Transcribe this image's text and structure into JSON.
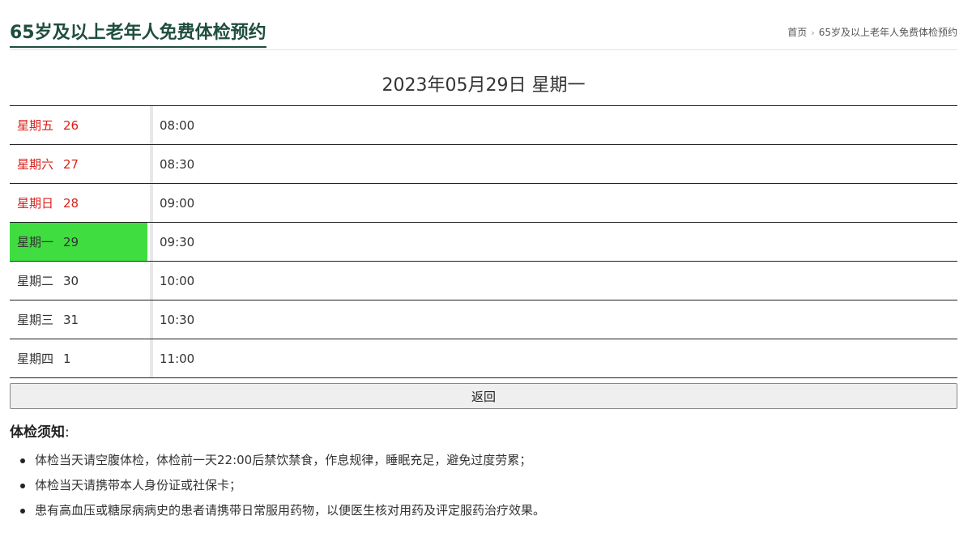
{
  "header": {
    "title": "65岁及以上老年人免费体检预约",
    "breadcrumb": {
      "home": "首页",
      "current": "65岁及以上老年人免费体检预约"
    }
  },
  "date_heading": "2023年05月29日 星期一",
  "schedule": [
    {
      "weekday": "星期五",
      "day": "26",
      "time": "08:00",
      "state": "weekend"
    },
    {
      "weekday": "星期六",
      "day": "27",
      "time": "08:30",
      "state": "weekend"
    },
    {
      "weekday": "星期日",
      "day": "28",
      "time": "09:00",
      "state": "weekend"
    },
    {
      "weekday": "星期一",
      "day": "29",
      "time": "09:30",
      "state": "selected"
    },
    {
      "weekday": "星期二",
      "day": "30",
      "time": "10:00",
      "state": "normal"
    },
    {
      "weekday": "星期三",
      "day": "31",
      "time": "10:30",
      "state": "normal"
    },
    {
      "weekday": "星期四",
      "day": "1",
      "time": "11:00",
      "state": "normal"
    }
  ],
  "colors": {
    "title": "#1f4e3d",
    "weekend_text": "#d9211b",
    "selected_bg": "#3fdd3f"
  },
  "back_button": "返回",
  "notice": {
    "title": "体检须知",
    "colon": ":",
    "items": [
      "体检当天请空腹体检，体检前一天22:00后禁饮禁食，作息规律，睡眠充足，避免过度劳累；",
      "体检当天请携带本人身份证或社保卡；",
      "患有高血压或糖尿病病史的患者请携带日常服用药物，以便医生核对用药及评定服药治疗效果。"
    ]
  }
}
